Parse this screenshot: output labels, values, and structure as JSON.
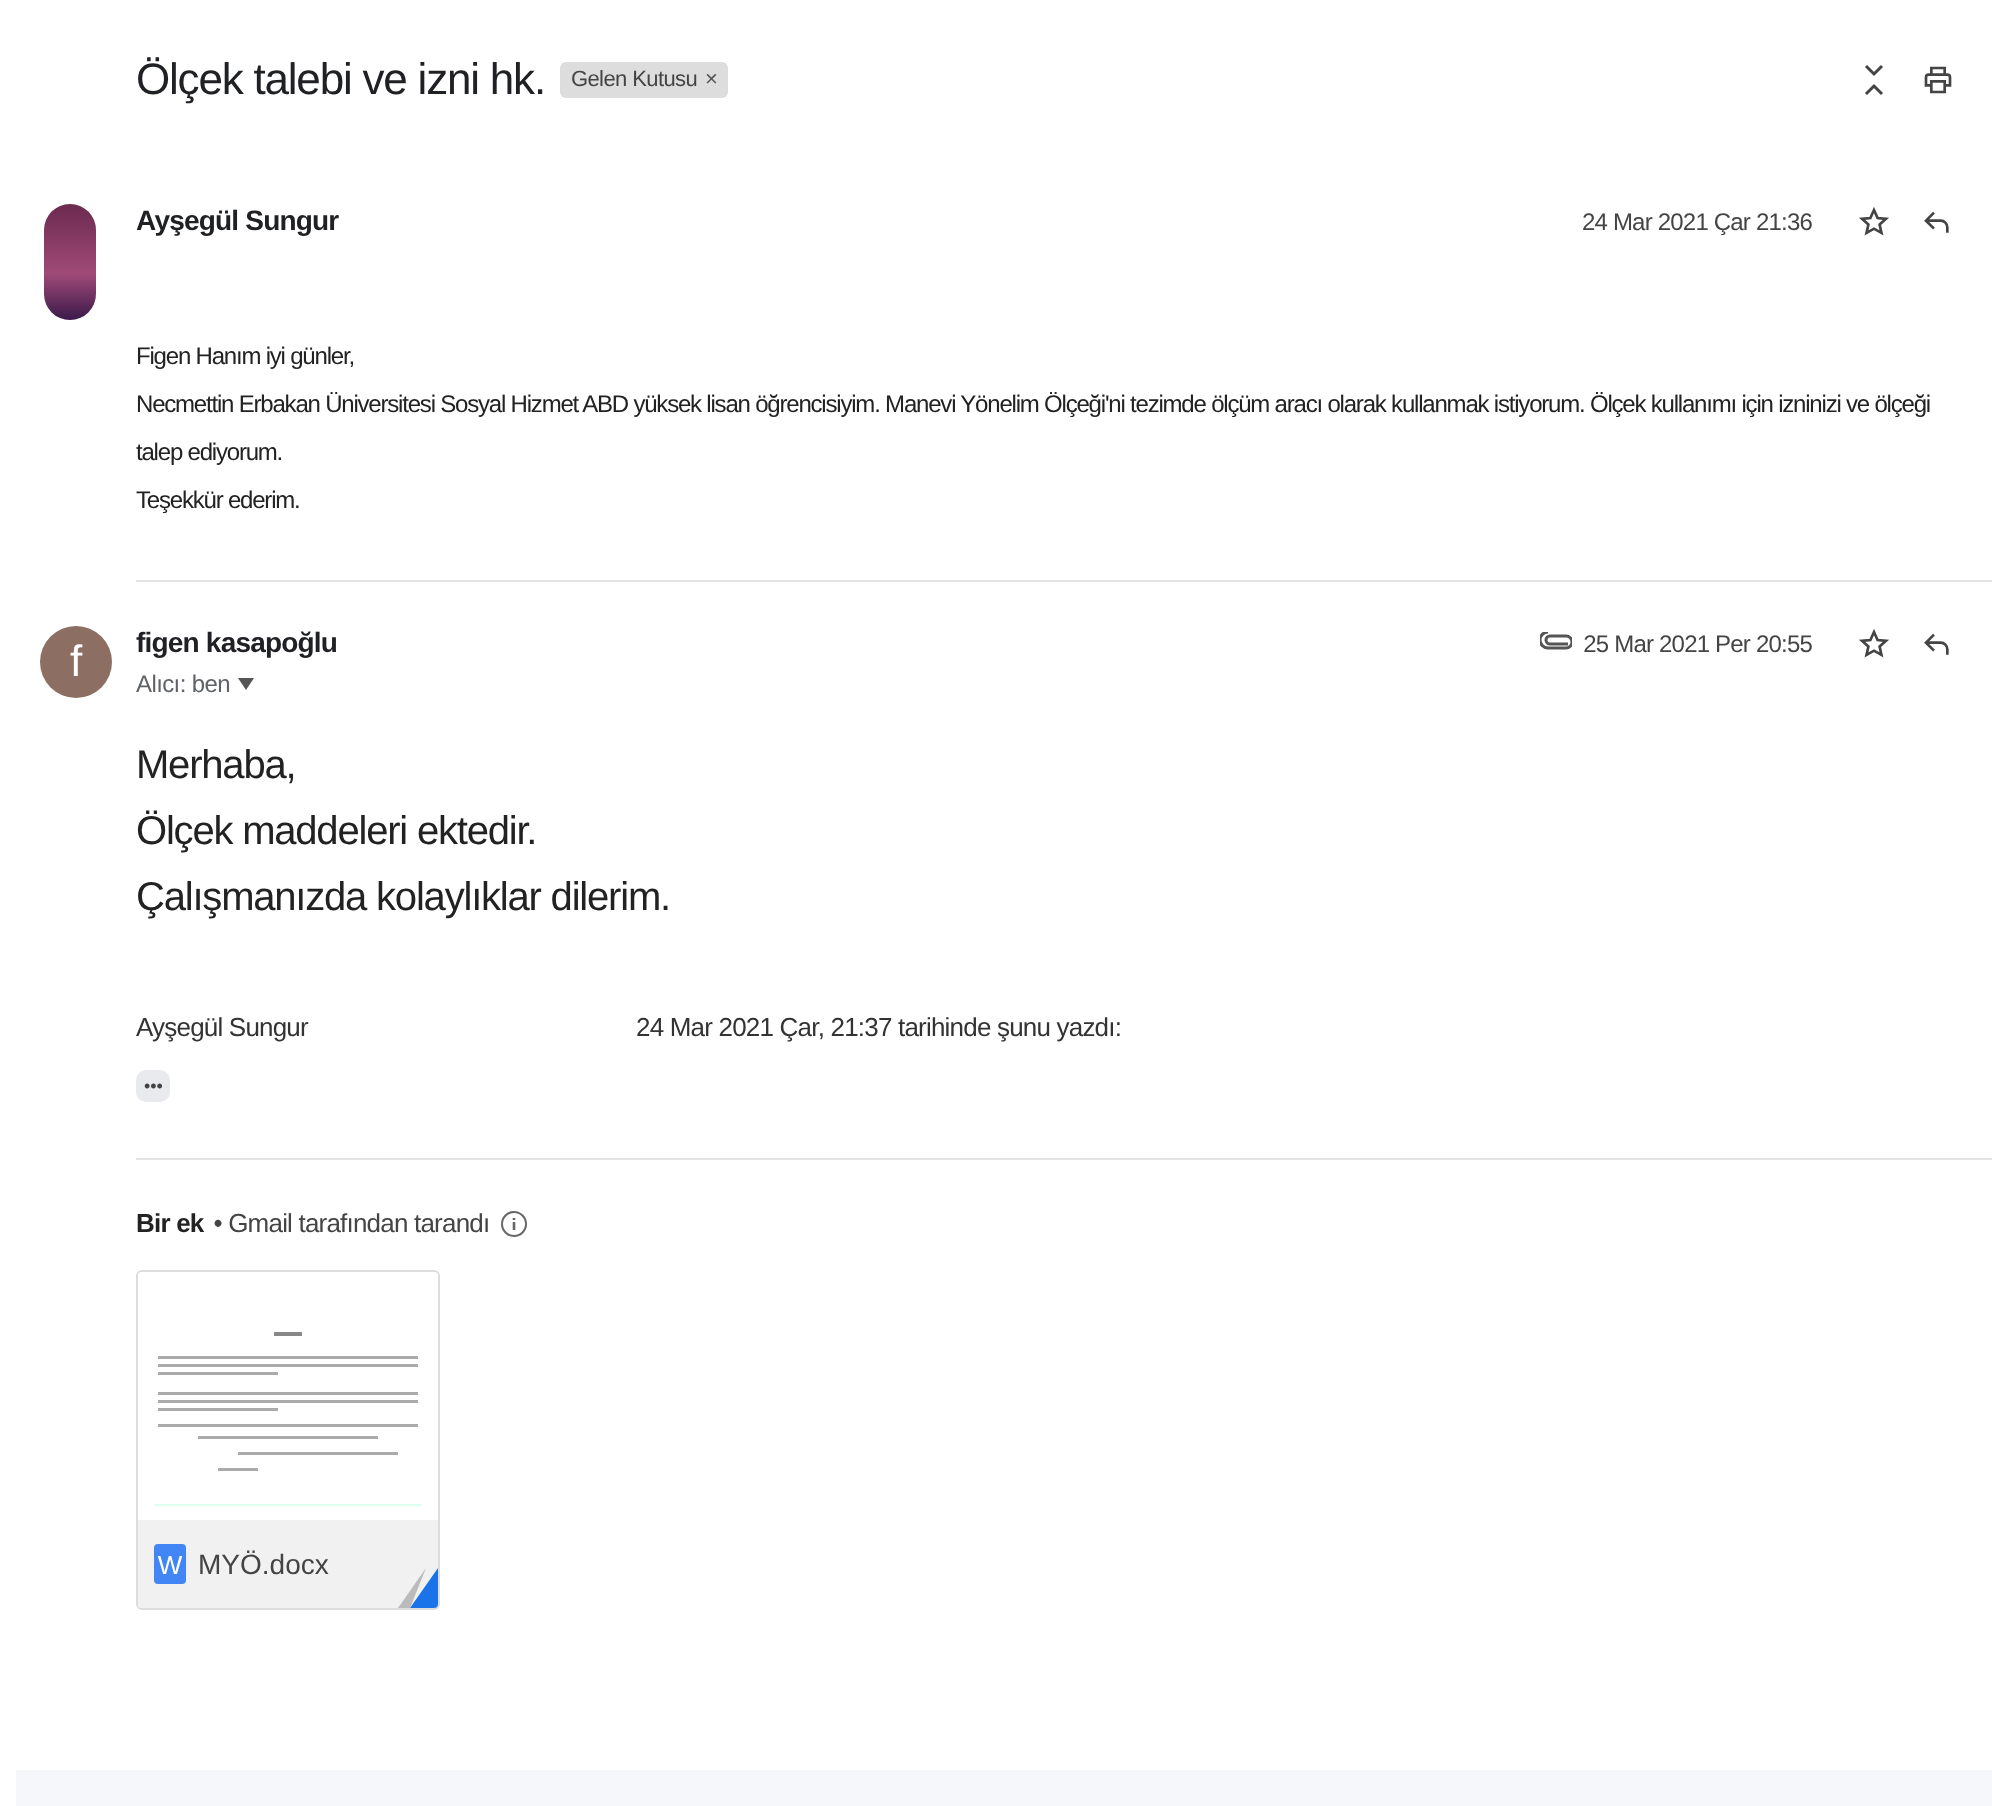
{
  "thread": {
    "subject": "Ölçek talebi ve izni hk.",
    "label": "Gelen Kutusu",
    "label_close": "×"
  },
  "messages": [
    {
      "kind": "original",
      "sender": "Ayşegül Sungur",
      "date": "24 Mar 2021 Çar 21:36",
      "has_attachment": false,
      "starred": false,
      "body": [
        "Figen Hanım iyi günler,",
        "Necmettin Erbakan Üniversitesi Sosyal Hizmet ABD yüksek lisan öğrencisiyim. Manevi Yönelim Ölçeği'ni tezimde ölçüm aracı olarak kullanmak istiyorum. Ölçek kullanımı için izninizi ve ölçeği talep ediyorum.",
        "Teşekkür ederim."
      ]
    },
    {
      "kind": "reply",
      "avatar_letter": "f",
      "sender": "figen kasapoğlu",
      "recipient": "Alıcı: ben",
      "date": "25 Mar 2021 Per 20:55",
      "has_attachment": true,
      "starred": false,
      "body": [
        "Merhaba,",
        "Ölçek maddeleri ektedir.",
        "Çalışmanızda kolaylıklar dilerim."
      ],
      "quote": {
        "sender": "Ayşegül Sungur",
        "header": "24 Mar 2021 Çar, 21:37 tarihinde şunu yazdı:",
        "expander": "•••"
      },
      "attachments_header": {
        "count": "Bir ek",
        "scan": "• Gmail tarafından tarandı"
      },
      "attachments": [
        {
          "file_name": "MYÖ.docx",
          "type_letter": "W"
        }
      ]
    }
  ]
}
